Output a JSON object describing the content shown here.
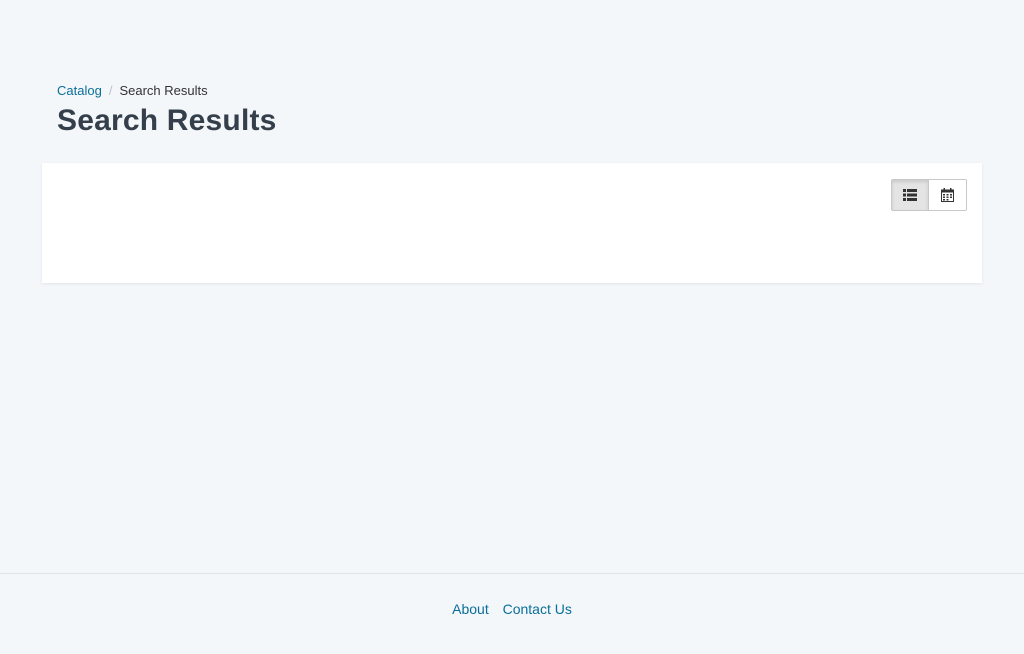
{
  "breadcrumb": {
    "items": [
      {
        "label": "Catalog"
      },
      {
        "label": "Search Results"
      }
    ],
    "separator": "/"
  },
  "page": {
    "title": "Search Results"
  },
  "results_panel": {
    "view_toggle": {
      "list": {
        "icon": "list-icon",
        "selected": true
      },
      "calendar": {
        "icon": "calendar-icon",
        "selected": false
      }
    }
  },
  "footer": {
    "links": [
      {
        "label": "About"
      },
      {
        "label": "Contact Us"
      }
    ]
  },
  "colors": {
    "background": "#f3f7fa",
    "link": "#0b6e99",
    "title": "#353f4b",
    "panel": "#ffffff"
  }
}
